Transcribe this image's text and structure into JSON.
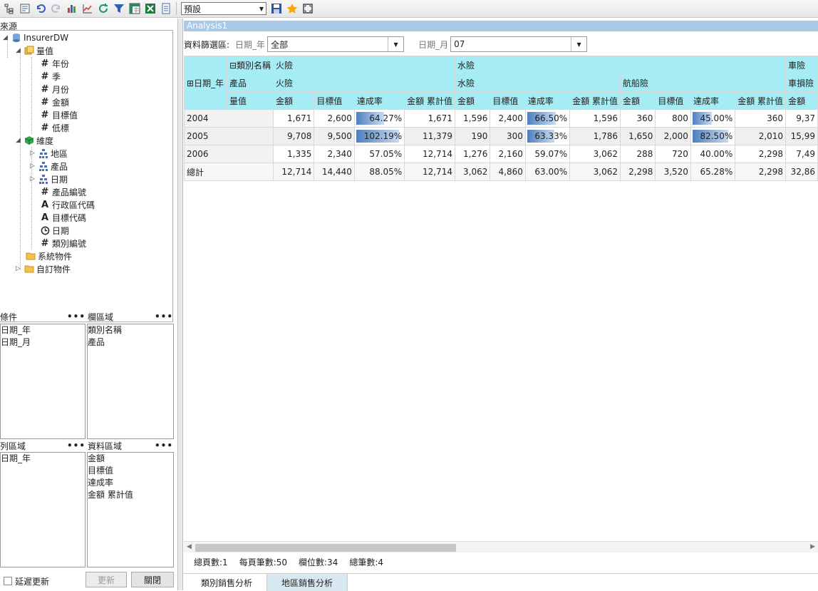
{
  "toolbar": {
    "view_select": "預設"
  },
  "source": {
    "label": "來源",
    "root": "InsurerDW",
    "measures_label": "量值",
    "measures": [
      "年份",
      "季",
      "月份",
      "金額",
      "目標值",
      "低標"
    ],
    "dimensions_label": "維度",
    "dimensions": [
      "地區",
      "產品",
      "日期"
    ],
    "attributes": [
      "產品編號",
      "行政區代碼",
      "目標代碼",
      "日期",
      "類別編號"
    ],
    "system_objects": "系統物件",
    "custom_objects": "自訂物件"
  },
  "zones": {
    "condition": {
      "label": "條件",
      "items": [
        "日期_年",
        "日期_月"
      ]
    },
    "column": {
      "label": "欄區域",
      "items": [
        "類別名稱",
        "產品"
      ]
    },
    "row": {
      "label": "列區域",
      "items": [
        "日期_年"
      ]
    },
    "data": {
      "label": "資料區域",
      "items": [
        "金額",
        "目標值",
        "達成率",
        "金額 累計值"
      ]
    },
    "dots": "•••"
  },
  "bottom": {
    "delay_update": "延遲更新",
    "update": "更新",
    "close": "關閉"
  },
  "analysis": {
    "title": "Analysis1",
    "filter_label": "資料篩選區:",
    "year_label": "日期_年",
    "year_value": "全部",
    "month_label": "日期_月",
    "month_value": "07"
  },
  "pivot": {
    "col_field1": "類別名稱",
    "col_field2": "產品",
    "measure_field": "量值",
    "row_field": "日期_年",
    "groups": [
      {
        "category": "火險",
        "products": [
          {
            "name": "火險"
          }
        ]
      },
      {
        "category": "水險",
        "products": [
          {
            "name": "水險"
          },
          {
            "name": "航船險"
          }
        ]
      },
      {
        "category": "車險",
        "products": [
          {
            "name": "車損險"
          }
        ]
      }
    ],
    "measures": [
      "金額",
      "目標值",
      "達成率",
      "金額 累計值"
    ],
    "rows": [
      {
        "label": "2004",
        "cells": [
          "1,671",
          "2,600",
          "64.27%",
          "1,671",
          "1,596",
          "2,400",
          "66.50%",
          "1,596",
          "360",
          "800",
          "45.00%",
          "360",
          "9,37"
        ],
        "pct": [
          64.27,
          66.5,
          45.0
        ]
      },
      {
        "label": "2005",
        "cells": [
          "9,708",
          "9,500",
          "102.19%",
          "11,379",
          "190",
          "300",
          "63.33%",
          "1,786",
          "1,650",
          "2,000",
          "82.50%",
          "2,010",
          "15,99"
        ],
        "pct": [
          102.19,
          63.33,
          82.5
        ]
      },
      {
        "label": "2006",
        "cells": [
          "1,335",
          "2,340",
          "57.05%",
          "12,714",
          "1,276",
          "2,160",
          "59.07%",
          "3,062",
          "288",
          "720",
          "40.00%",
          "2,298",
          "7,49"
        ]
      },
      {
        "label": "總計",
        "cells": [
          "12,714",
          "14,440",
          "88.05%",
          "12,714",
          "3,062",
          "4,860",
          "63.00%",
          "3,062",
          "2,298",
          "3,520",
          "65.28%",
          "2,298",
          "32,86"
        ]
      }
    ]
  },
  "status": {
    "pages": "總頁數:1",
    "per_page": "每頁筆數:50",
    "cols": "欄位數:34",
    "records": "總筆數:4"
  },
  "tabs": [
    "類別銷售分析",
    "地區銷售分析"
  ]
}
